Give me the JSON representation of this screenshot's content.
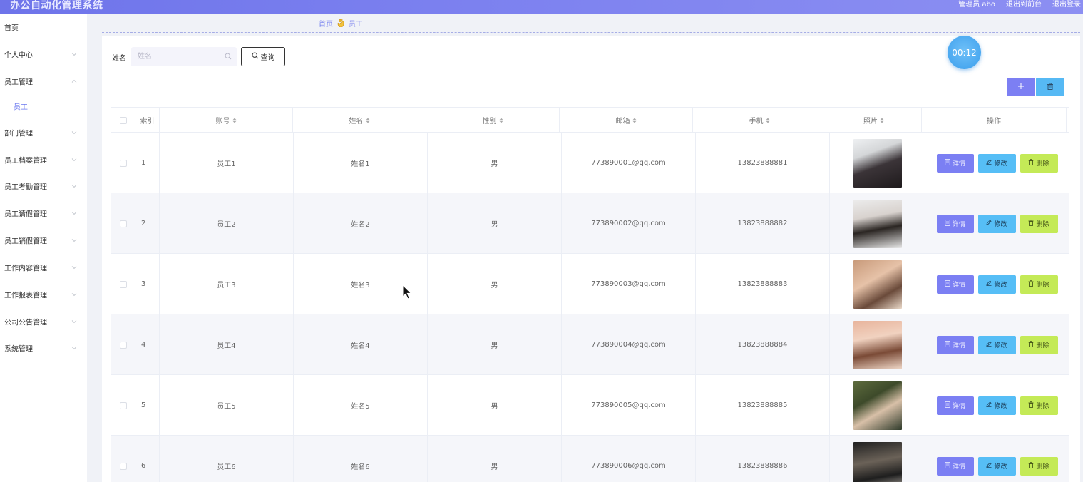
{
  "header": {
    "app_title": "办公自动化管理系统",
    "admin_label": "管理员 abo",
    "front_label": "退出到前台",
    "logout_label": "退出登录"
  },
  "sidebar": {
    "items": [
      {
        "label": "首页",
        "has_arrow": false
      },
      {
        "label": "个人中心",
        "has_arrow": true
      },
      {
        "label": "员工管理",
        "has_arrow": true,
        "expanded": true
      },
      {
        "label": "员工",
        "has_arrow": false,
        "active": true
      },
      {
        "label": "部门管理",
        "has_arrow": true
      },
      {
        "label": "员工档案管理",
        "has_arrow": true
      },
      {
        "label": "员工考勤管理",
        "has_arrow": true
      },
      {
        "label": "员工请假管理",
        "has_arrow": true
      },
      {
        "label": "员工销假管理",
        "has_arrow": true
      },
      {
        "label": "工作内容管理",
        "has_arrow": true
      },
      {
        "label": "工作报表管理",
        "has_arrow": true
      },
      {
        "label": "公司公告管理",
        "has_arrow": true
      },
      {
        "label": "系统管理",
        "has_arrow": true
      }
    ]
  },
  "breadcrumb": {
    "home": "首页",
    "current": "员工"
  },
  "search": {
    "label": "姓名",
    "placeholder": "姓名",
    "value": "",
    "button_label": "查询"
  },
  "timer": "00:12",
  "table": {
    "headers": {
      "index": "索引",
      "account": "账号",
      "name": "姓名",
      "gender": "性别",
      "email": "邮箱",
      "phone": "手机",
      "photo": "照片",
      "actions": "操作"
    },
    "actions": {
      "detail": "详情",
      "edit": "修改",
      "delete": "删除"
    },
    "rows": [
      {
        "index": "1",
        "account": "员工1",
        "name": "姓名1",
        "gender": "男",
        "email": "773890001@qq.com",
        "phone": "13823888881"
      },
      {
        "index": "2",
        "account": "员工2",
        "name": "姓名2",
        "gender": "男",
        "email": "773890002@qq.com",
        "phone": "13823888882"
      },
      {
        "index": "3",
        "account": "员工3",
        "name": "姓名3",
        "gender": "男",
        "email": "773890003@qq.com",
        "phone": "13823888883"
      },
      {
        "index": "4",
        "account": "员工4",
        "name": "姓名4",
        "gender": "男",
        "email": "773890004@qq.com",
        "phone": "13823888884"
      },
      {
        "index": "5",
        "account": "员工5",
        "name": "姓名5",
        "gender": "男",
        "email": "773890005@qq.com",
        "phone": "13823888885"
      },
      {
        "index": "6",
        "account": "员工6",
        "name": "姓名6",
        "gender": "男",
        "email": "773890006@qq.com",
        "phone": "13823888886"
      }
    ]
  },
  "colors": {
    "topbar": "#7378ec",
    "accent": "#6b78ef",
    "detail_button": "#7b7ff3",
    "edit_button": "#56bef6",
    "delete_button": "#c4ea57",
    "timer": "#4aa8f0"
  }
}
